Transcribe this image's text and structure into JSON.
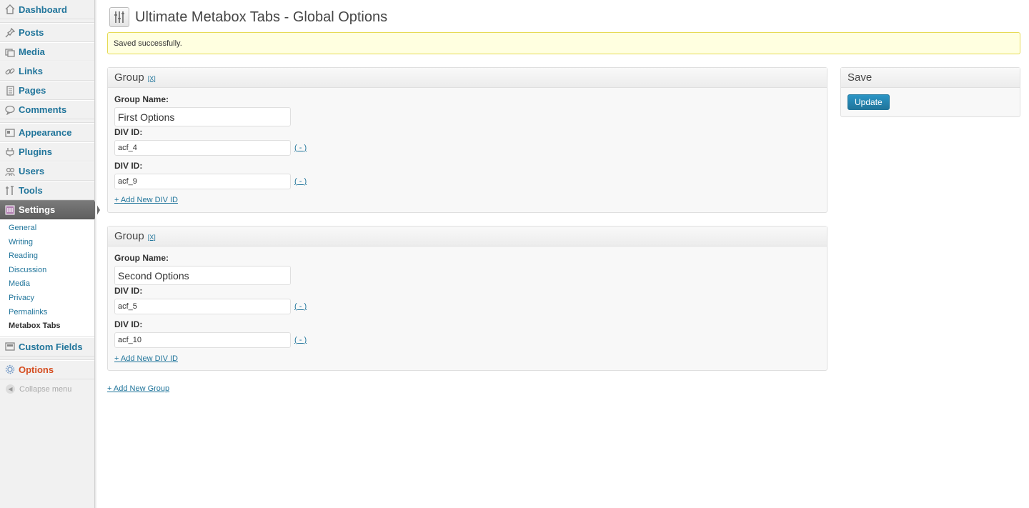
{
  "sidebar": {
    "items": [
      {
        "label": "Dashboard",
        "icon": "home-icon"
      },
      {
        "label": "Posts",
        "icon": "pin-icon"
      },
      {
        "label": "Media",
        "icon": "media-icon"
      },
      {
        "label": "Links",
        "icon": "link-icon"
      },
      {
        "label": "Pages",
        "icon": "page-icon"
      },
      {
        "label": "Comments",
        "icon": "comment-icon"
      },
      {
        "label": "Appearance",
        "icon": "appearance-icon"
      },
      {
        "label": "Plugins",
        "icon": "plugin-icon"
      },
      {
        "label": "Users",
        "icon": "users-icon"
      },
      {
        "label": "Tools",
        "icon": "tools-icon"
      },
      {
        "label": "Settings",
        "icon": "settings-icon"
      },
      {
        "label": "Custom Fields",
        "icon": "custom-fields-icon"
      },
      {
        "label": "Options",
        "icon": "options-icon"
      }
    ],
    "settings_submenu": [
      "General",
      "Writing",
      "Reading",
      "Discussion",
      "Media",
      "Privacy",
      "Permalinks",
      "Metabox Tabs"
    ],
    "collapse_label": "Collapse menu"
  },
  "page": {
    "title": "Ultimate Metabox Tabs - Global Options",
    "notice": "Saved successfully.",
    "add_group_label": "+ Add New Group"
  },
  "groups": [
    {
      "heading": "Group",
      "remove_label": "[X]",
      "name_label": "Group Name:",
      "name_value": "First Options",
      "div_label": "DIV ID:",
      "div_ids": [
        "acf_4",
        "acf_9"
      ],
      "remove_div_label": "( - )",
      "add_div_label": "+ Add New DIV ID"
    },
    {
      "heading": "Group",
      "remove_label": "[X]",
      "name_label": "Group Name:",
      "name_value": "Second Options",
      "div_label": "DIV ID:",
      "div_ids": [
        "acf_5",
        "acf_10"
      ],
      "remove_div_label": "( - )",
      "add_div_label": "+ Add New DIV ID"
    }
  ],
  "save_box": {
    "heading": "Save",
    "button_label": "Update"
  },
  "colors": {
    "link": "#21759b",
    "notice_bg": "#ffffe0",
    "current_menu": "#6b6b6b",
    "options_accent": "#d54e21"
  }
}
